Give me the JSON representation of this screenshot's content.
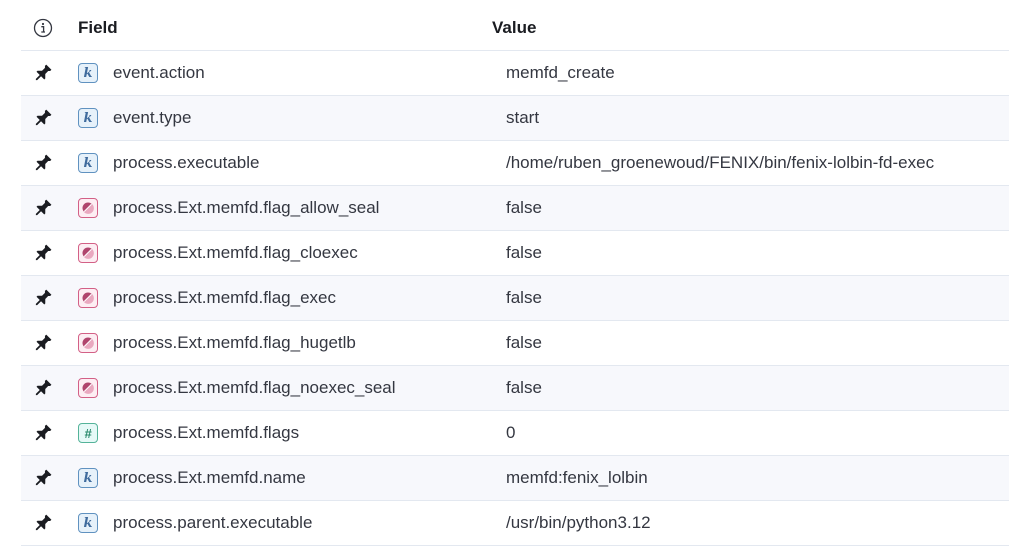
{
  "header": {
    "field_label": "Field",
    "value_label": "Value",
    "info_icon": "info-icon"
  },
  "rows": [
    {
      "type": "keyword",
      "type_glyph": "k",
      "field": "event.action",
      "value": "memfd_create"
    },
    {
      "type": "keyword",
      "type_glyph": "k",
      "field": "event.type",
      "value": "start"
    },
    {
      "type": "keyword",
      "type_glyph": "k",
      "field": "process.executable",
      "value": "/home/ruben_groenewoud/FENIX/bin/fenix-lolbin-fd-exec"
    },
    {
      "type": "boolean",
      "type_glyph": "",
      "field": "process.Ext.memfd.flag_allow_seal",
      "value": "false"
    },
    {
      "type": "boolean",
      "type_glyph": "",
      "field": "process.Ext.memfd.flag_cloexec",
      "value": "false"
    },
    {
      "type": "boolean",
      "type_glyph": "",
      "field": "process.Ext.memfd.flag_exec",
      "value": "false"
    },
    {
      "type": "boolean",
      "type_glyph": "",
      "field": "process.Ext.memfd.flag_hugetlb",
      "value": "false"
    },
    {
      "type": "boolean",
      "type_glyph": "",
      "field": "process.Ext.memfd.flag_noexec_seal",
      "value": "false"
    },
    {
      "type": "number",
      "type_glyph": "#",
      "field": "process.Ext.memfd.flags",
      "value": "0"
    },
    {
      "type": "keyword",
      "type_glyph": "k",
      "field": "process.Ext.memfd.name",
      "value": "memfd:fenix_lolbin"
    },
    {
      "type": "keyword",
      "type_glyph": "k",
      "field": "process.parent.executable",
      "value": "/usr/bin/python3.12"
    }
  ],
  "icons": {
    "pin": "pin-icon",
    "keyword": "keyword-type-icon",
    "boolean": "boolean-type-icon",
    "number": "number-type-icon"
  },
  "colors": {
    "keyword": "#6092c0",
    "boolean": "#d36086",
    "number": "#54b399",
    "alt_row": "#f7f8fc"
  }
}
